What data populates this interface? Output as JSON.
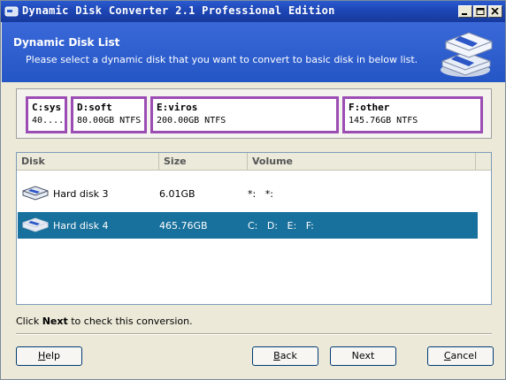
{
  "window": {
    "title": "Dynamic Disk Converter 2.1 Professional Edition"
  },
  "header": {
    "title": "Dynamic Disk List",
    "subtitle": "Please select a dynamic disk that you want to convert to basic disk in below list."
  },
  "partitions": [
    {
      "letter": "C:sys",
      "info": "40...."
    },
    {
      "letter": "D:soft",
      "info": "80.00GB NTFS"
    },
    {
      "letter": "E:viros",
      "info": "200.00GB NTFS"
    },
    {
      "letter": "F:other",
      "info": "145.76GB NTFS"
    }
  ],
  "disk_list": {
    "columns": [
      "Disk",
      "Size",
      "Volume"
    ],
    "rows": [
      {
        "disk": "Hard disk 3",
        "size": "6.01GB",
        "volume": "*:   *:",
        "selected": false
      },
      {
        "disk": "Hard disk 4",
        "size": "465.76GB",
        "volume": "C:   D:   E:   F:",
        "selected": true
      }
    ]
  },
  "hint": {
    "prefix": "Click ",
    "bold": "Next",
    "suffix": " to check this conversion."
  },
  "buttons": {
    "help": {
      "mnemonic": "H",
      "rest": "elp"
    },
    "back": {
      "mnemonic": "B",
      "rest": "ack"
    },
    "next": {
      "label": "Next"
    },
    "cancel": {
      "mnemonic": "C",
      "rest": "ancel"
    }
  },
  "colors": {
    "title_bar": "#1f48b8",
    "header": "#2556c6",
    "partition_border": "#9b4db4",
    "selection": "#18709c"
  }
}
